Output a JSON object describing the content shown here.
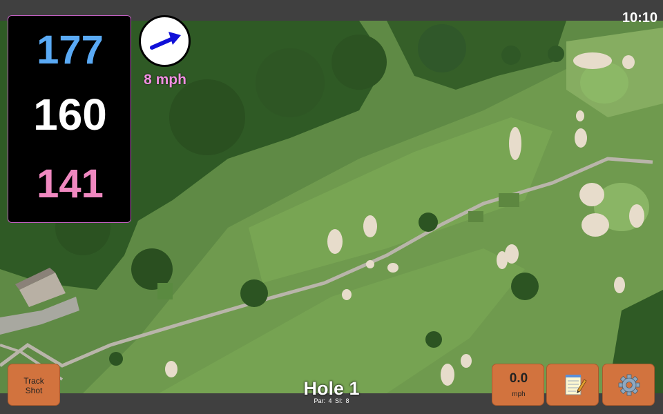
{
  "status": {
    "time": "10:10"
  },
  "distances": {
    "back": "177",
    "middle": "160",
    "front": "141"
  },
  "wind": {
    "speed_label": "8 mph",
    "direction_icon": "arrow-icon"
  },
  "hole": {
    "title": "Hole 1",
    "par_label": "Par: 4",
    "si_label": "SI: 8"
  },
  "buttons": {
    "track_shot_line1": "Track",
    "track_shot_line2": "Shot",
    "speed_value": "0.0",
    "speed_unit": "mph",
    "notes_icon": "notepad-icon",
    "settings_icon": "gear-icon"
  },
  "colors": {
    "back_distance": "#5aaaf5",
    "middle_distance": "#ffffff",
    "front_distance": "#f088c0",
    "wind_label": "#f090e0",
    "button_bg": "#d2733e"
  }
}
